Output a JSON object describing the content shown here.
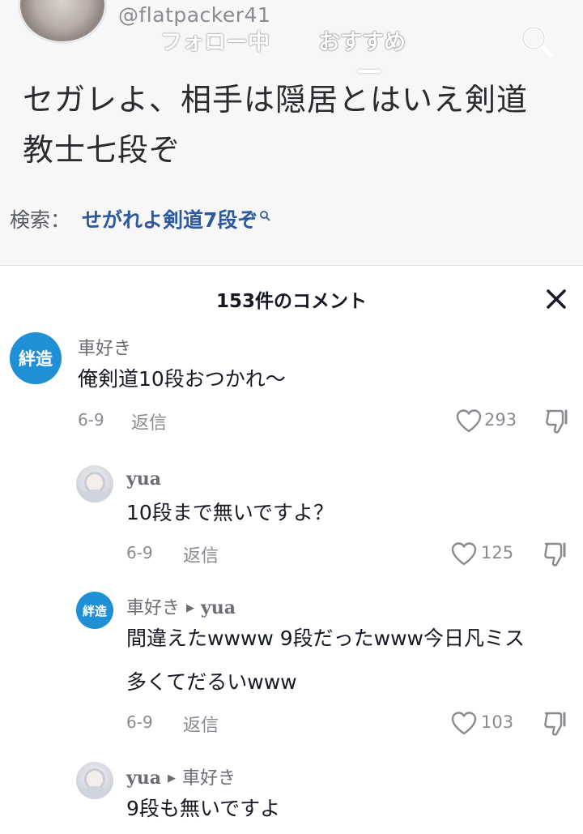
{
  "post": {
    "author_handle": "@flatpacker41",
    "tabs": [
      "フォロー中",
      "おすすめ"
    ],
    "caption_lines": [
      "セガレよ、相手は隠居とはいえ剣道",
      "教士七段ぞ"
    ],
    "search_label": "検索：",
    "search_term": "せがれよ剣道7段ぞ"
  },
  "comments_sheet": {
    "title": "153件のコメント",
    "comments": [
      {
        "avatar_text": "絆造",
        "name": "車好き",
        "text": "俺剣道10段おつかれ〜",
        "date": "6-9",
        "reply_label": "返信",
        "likes": "293"
      },
      {
        "name": "yua",
        "text": "10段まで無いですよ？",
        "date": "6-9",
        "reply_label": "返信",
        "likes": "125"
      },
      {
        "avatar_text": "絆造",
        "name": "車好き",
        "reply_to": "yua",
        "text_lines": [
          "間違えたwwww 9段だったwww今日凡ミス",
          "多くてだるいwww"
        ],
        "date": "6-9",
        "reply_label": "返信",
        "likes": "103"
      },
      {
        "name": "yua",
        "reply_to": "車好き",
        "text": "9段も無いですよ"
      }
    ]
  },
  "colors": {
    "accent_link": "#2c5aa0",
    "avatar_badge": "#1f8fd6",
    "secondary_text": "#8a8b91"
  }
}
